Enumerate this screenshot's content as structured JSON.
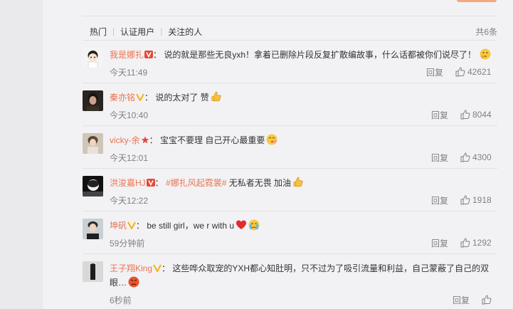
{
  "tabs": [
    "热门",
    "认证用户",
    "关注的人"
  ],
  "total": "共6条",
  "reply_label": "回复",
  "colors": {
    "accent": "#eb7350",
    "vip_badge": "#f28c1f",
    "red_badge": "#e9473b",
    "gold_badge": "#f5b51e"
  },
  "comments": [
    {
      "user": "我是娜扎",
      "badge": "red-v-badge",
      "sep": "：",
      "text": "说的就是那些无良yxh！拿着已删除片段反复扩散编故事，什么话都被你们说尽了！",
      "emoji": "thinking-emoji",
      "time": "今天11:49",
      "likes": "42621"
    },
    {
      "user": "秦亦铭",
      "badge": "gold-v-badge",
      "sep": "：",
      "text": "说的太对了 赞",
      "emoji": "thumbs-up-emoji",
      "time": "今天10:40",
      "likes": "8044"
    },
    {
      "user": "vicky-余",
      "badge": "red-star-badge",
      "sep": "：",
      "text": "宝宝不要理 自己开心最重要",
      "emoji": "kiss-emoji",
      "time": "今天12:01",
      "likes": "4300"
    },
    {
      "user": "洪浚嘉HJ",
      "badge": "red-v-badge",
      "sep": "：",
      "topic": "#娜扎风起霓裳#",
      "text": " 无私者无畏 加油",
      "emoji": "thumbs-up-emoji",
      "time": "今天12:22",
      "likes": "1918"
    },
    {
      "user": "坤矾",
      "badge": "gold-v-badge",
      "sep": "：",
      "text": "be still girl，we r with u",
      "emoji": "heart-emoji",
      "time": "59分钟前",
      "likes": "1292"
    },
    {
      "user": "王子翔King",
      "badge": "gold-v-badge",
      "sep": "：",
      "text": "这些哗众取宠的YXH都心知肚明，只不过为了吸引流量和利益，自己蒙蔽了自己的双眼…",
      "emoji": "angry-emoji",
      "time": "6秒前",
      "likes": ""
    }
  ]
}
